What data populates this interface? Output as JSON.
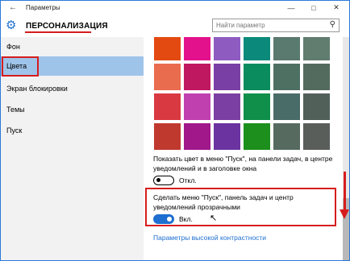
{
  "window": {
    "title": "Параметры",
    "back_icon": "arrow-left-icon",
    "minimize_icon": "minimize-icon",
    "maximize_icon": "maximize-icon",
    "close_icon": "close-icon"
  },
  "header": {
    "title": "ПЕРСОНАЛИЗАЦИЯ",
    "icon": "gear-icon",
    "search_placeholder": "Найти параметр"
  },
  "sidebar": {
    "items": [
      {
        "label": "Фон",
        "active": false
      },
      {
        "label": "Цвета",
        "active": true
      },
      {
        "label": "Экран блокировки",
        "active": false
      },
      {
        "label": "Темы",
        "active": false
      },
      {
        "label": "Пуск",
        "active": false
      }
    ]
  },
  "colors": {
    "accent": "#1e6fd0",
    "highlight": "#d61d1d",
    "sidebar_active": "#9fc4ea",
    "swatches": [
      [
        "#e34a12",
        "#e3128c",
        "#8e5cc1",
        "#0b8a7c",
        "#5a7a70",
        "#607d70"
      ],
      [
        "#ea6c4e",
        "#c01860",
        "#7a3fa5",
        "#0a8c5e",
        "#4e7063",
        "#536b5e"
      ],
      [
        "#d93a41",
        "#c040b0",
        "#7b3fa3",
        "#0f8f4a",
        "#4a6c68",
        "#52605a"
      ],
      [
        "#c0392f",
        "#a0188a",
        "#6b33a0",
        "#1c8f1c",
        "#566a60",
        "#5a5e5a"
      ]
    ]
  },
  "content": {
    "show_color_text": "Показать цвет в меню \"Пуск\", на панели задач, в центре уведомлений и в заголовке окна",
    "show_color_toggle_label": "Откл.",
    "show_color_toggle_state": "off",
    "transparency_text": "Сделать меню \"Пуск\", панель задач и центр уведомлений прозрачными",
    "transparency_toggle_label": "Вкл.",
    "transparency_toggle_state": "on",
    "high_contrast_link": "Параметры высокой контрастности"
  }
}
